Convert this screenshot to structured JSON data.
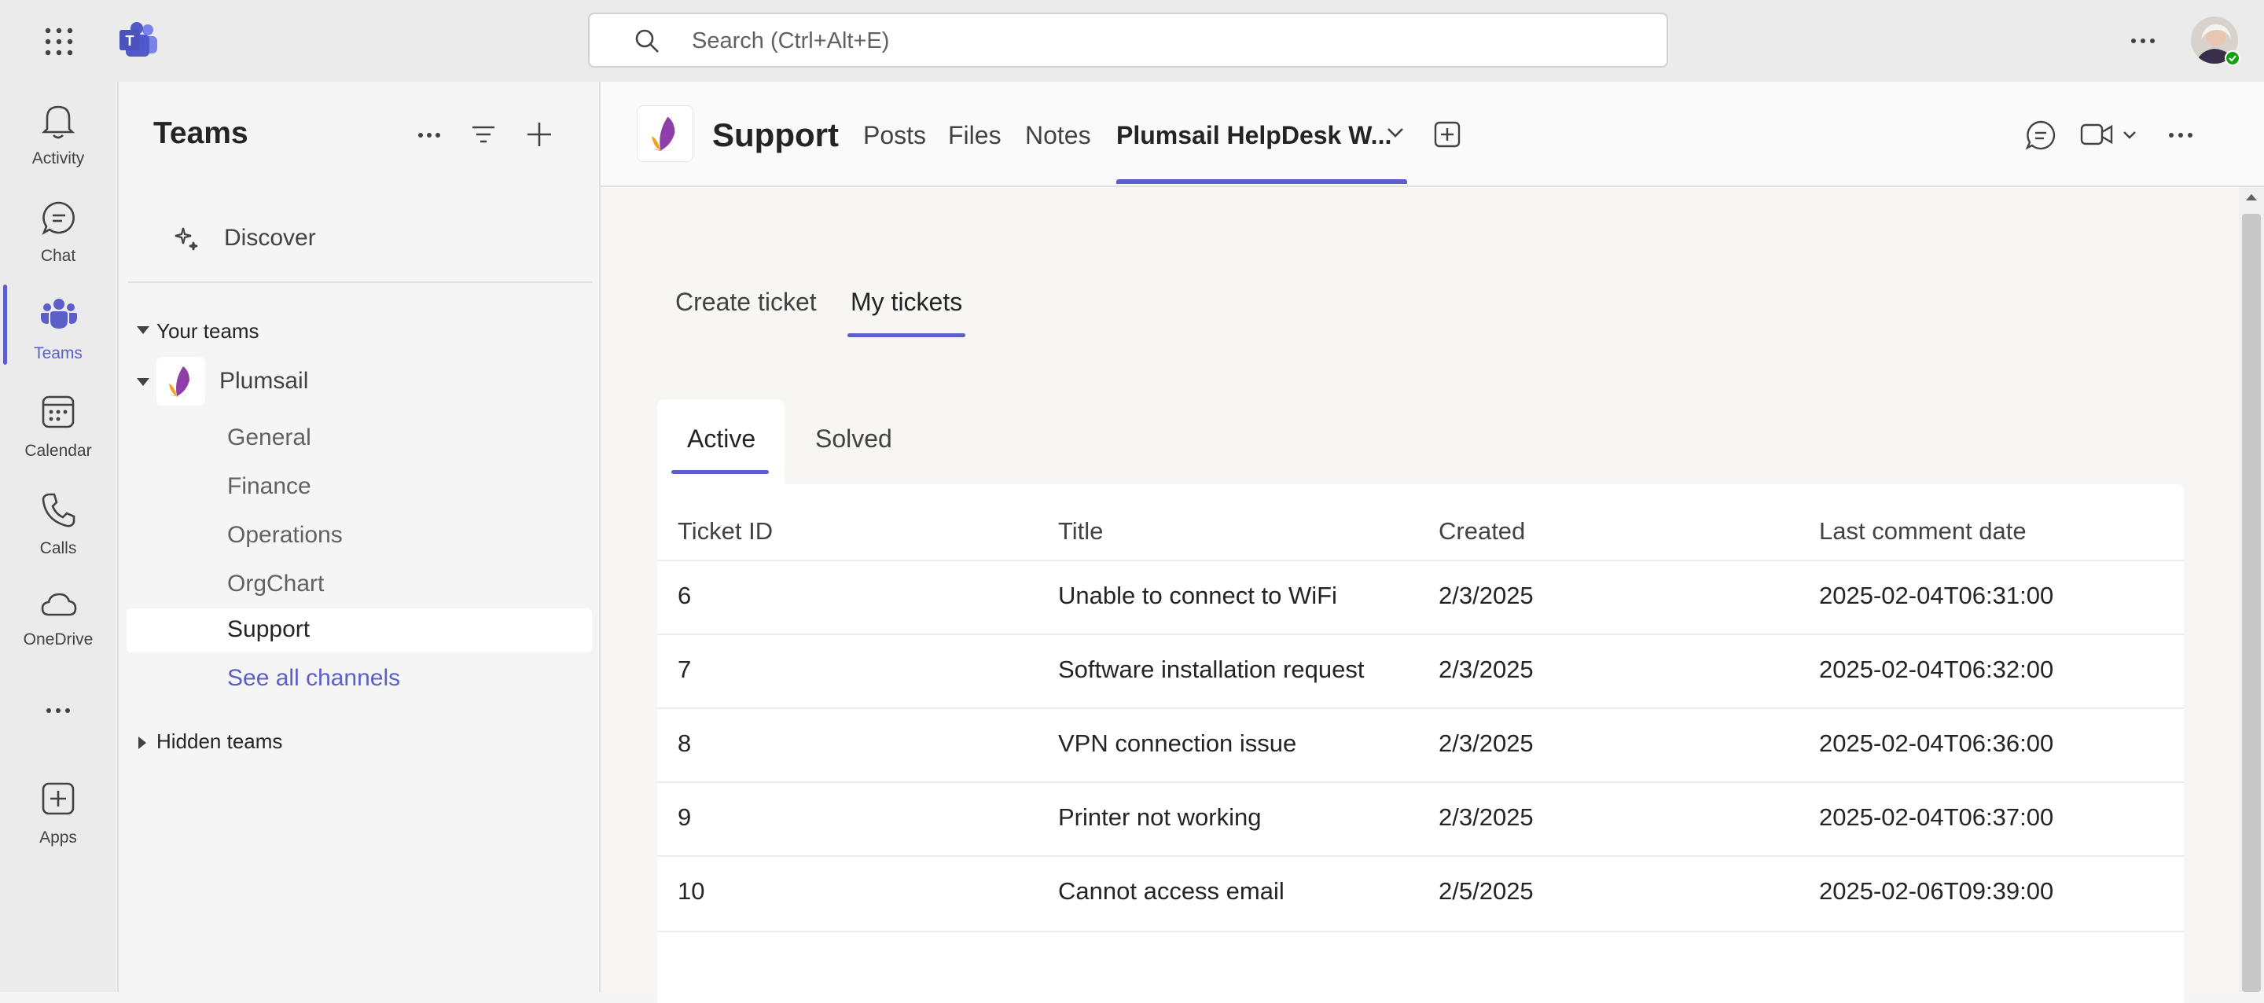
{
  "search": {
    "placeholder": "Search (Ctrl+Alt+E)"
  },
  "rail": {
    "items": [
      {
        "label": "Activity",
        "icon": "bell-icon"
      },
      {
        "label": "Chat",
        "icon": "chat-icon"
      },
      {
        "label": "Teams",
        "icon": "teams-icon",
        "active": true
      },
      {
        "label": "Calendar",
        "icon": "calendar-icon"
      },
      {
        "label": "Calls",
        "icon": "phone-icon"
      },
      {
        "label": "OneDrive",
        "icon": "cloud-icon"
      },
      {
        "label": "Apps",
        "icon": "add-app-icon"
      }
    ]
  },
  "pane": {
    "title": "Teams",
    "discover": "Discover",
    "your_teams": "Your teams",
    "team": "Plumsail",
    "channels": [
      "General",
      "Finance",
      "Operations",
      "OrgChart",
      "Support"
    ],
    "see_all": "See all channels",
    "hidden_teams": "Hidden teams"
  },
  "channel": {
    "name": "Support",
    "tabs": [
      "Posts",
      "Files",
      "Notes",
      "Plumsail HelpDesk W..."
    ]
  },
  "content": {
    "top_tabs": [
      "Create ticket",
      "My tickets"
    ],
    "sub_tabs": [
      "Active",
      "Solved"
    ],
    "columns": [
      "Ticket ID",
      "Title",
      "Created",
      "Last comment date"
    ],
    "rows": [
      [
        "6",
        "Unable to connect to WiFi",
        "2/3/2025",
        "2025-02-04T06:31:00"
      ],
      [
        "7",
        "Software installation request",
        "2/3/2025",
        "2025-02-04T06:32:00"
      ],
      [
        "8",
        "VPN connection issue",
        "2/3/2025",
        "2025-02-04T06:36:00"
      ],
      [
        "9",
        "Printer not working",
        "2/3/2025",
        "2025-02-04T06:37:00"
      ],
      [
        "10",
        "Cannot access email",
        "2/5/2025",
        "2025-02-06T09:39:00"
      ]
    ]
  },
  "colors": {
    "accent": "#5b5fc7",
    "link": "#5b5fc7"
  }
}
